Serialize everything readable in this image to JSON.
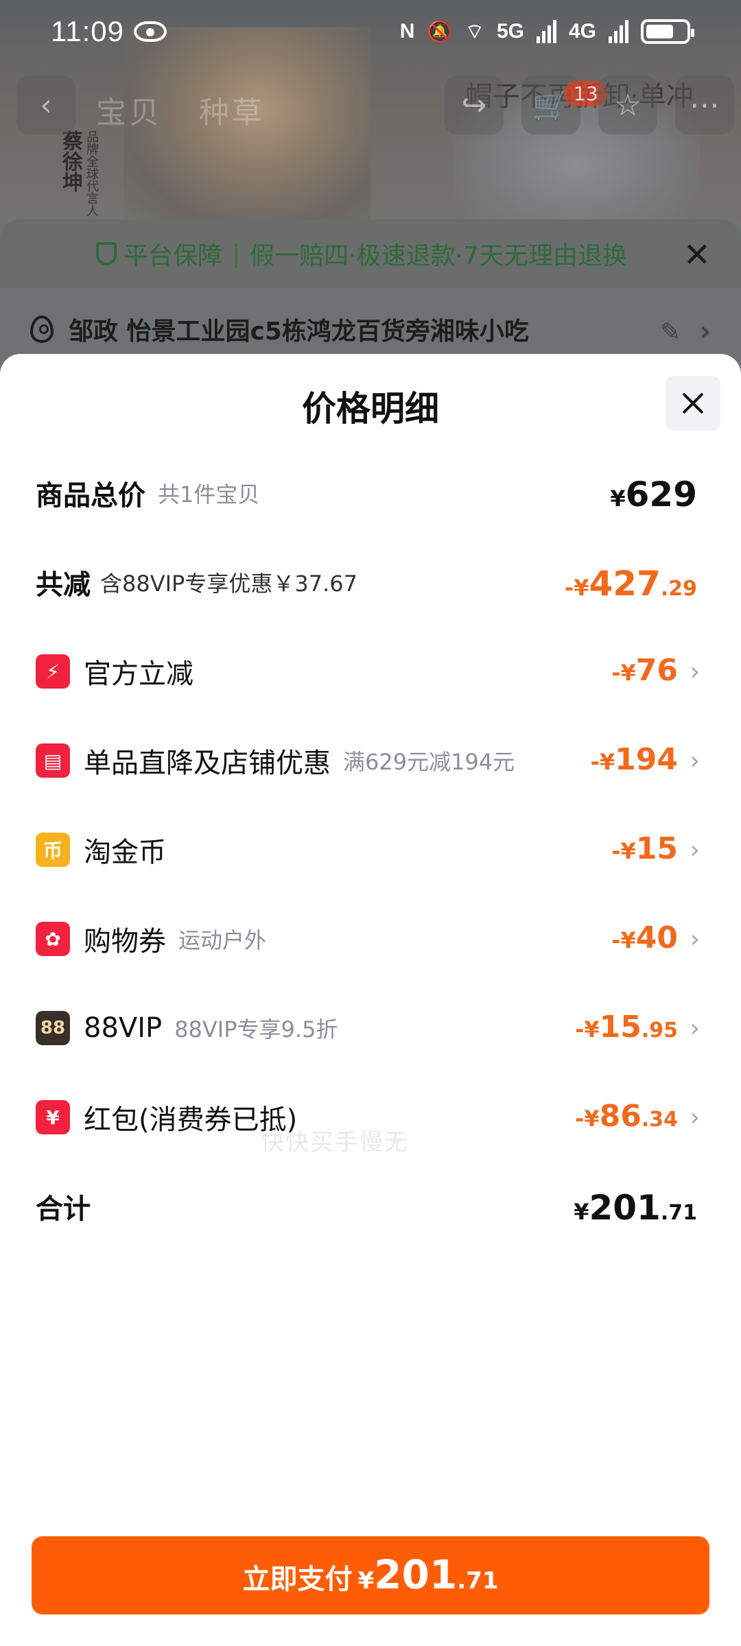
{
  "status_bar": {
    "time": "11:09",
    "net1": "5G",
    "net2": "4G"
  },
  "background": {
    "nav_tabs": [
      "宝贝",
      "种草"
    ],
    "cart_count": "13",
    "product_title": "帽子不再拆卸·单冲",
    "signature": "蔡徐坤",
    "endorse_text": "品牌全球代言人",
    "guarantee": {
      "label": "平台保障",
      "items": "假一赔四·极速退款·7天无理由退换"
    },
    "address": "邹政  怡景工业园c5栋鸿龙百货旁湘味小吃"
  },
  "sheet": {
    "title": "价格明细",
    "total_price": {
      "label": "商品总价",
      "sub": "共1件宝贝",
      "currency": "¥",
      "amount": "629"
    },
    "total_reduction": {
      "label": "共减",
      "sub": "含88VIP专享优惠￥37.67",
      "sign": "-¥",
      "amount": "427",
      "decimals": ".29"
    },
    "discounts": [
      {
        "icon": "lightning-icon",
        "label": "官方立减",
        "sub": "",
        "sign": "-¥",
        "amount": "76",
        "decimals": ""
      },
      {
        "icon": "shop-icon",
        "label": "单品直降及店铺优惠",
        "sub": "满629元减194元",
        "sign": "-¥",
        "amount": "194",
        "decimals": ""
      },
      {
        "icon": "coin-icon",
        "label": "淘金币",
        "sub": "",
        "sign": "-¥",
        "amount": "15",
        "decimals": ""
      },
      {
        "icon": "coupon-icon",
        "label": "购物券",
        "sub": "运动户外",
        "sign": "-¥",
        "amount": "40",
        "decimals": ""
      },
      {
        "icon": "vip-icon",
        "label": "88VIP",
        "sub": "88VIP专享9.5折",
        "sign": "-¥",
        "amount": "15",
        "decimals": ".95"
      },
      {
        "icon": "red-packet-icon",
        "label": "红包(消费券已抵)",
        "sub": "",
        "sign": "-¥",
        "amount": "86",
        "decimals": ".34"
      }
    ],
    "watermark": "快快买手慢无",
    "subtotal": {
      "label": "合计",
      "currency": "¥",
      "amount": "201",
      "decimals": ".71"
    },
    "pay_button": {
      "label": "立即支付",
      "currency": "¥",
      "amount": "201",
      "decimals": ".71"
    }
  },
  "colors": {
    "accent": "#ff5d05",
    "discount": "#f06a1c",
    "icon_red": "#f0223e",
    "icon_gold": "#f7b11d"
  }
}
